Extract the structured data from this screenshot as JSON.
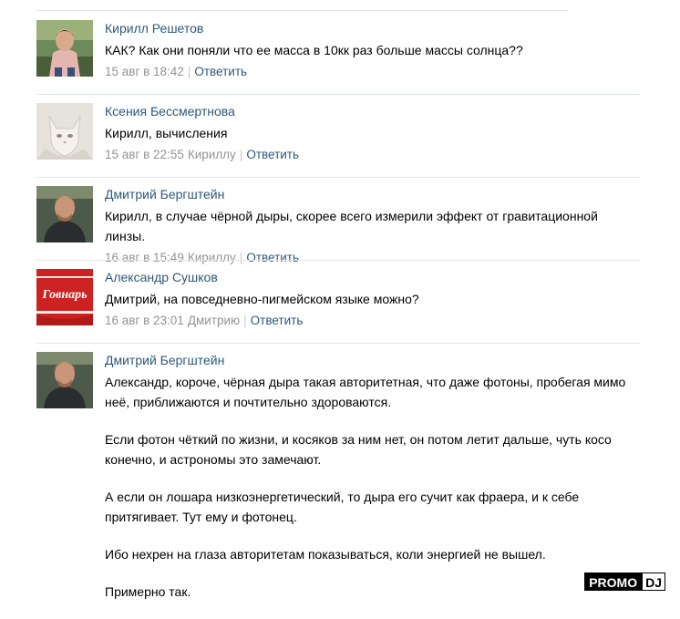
{
  "comments": [
    {
      "author": "Кирилл Решетов",
      "text": "КАК? Как они поняли что ее масса в 10кк раз больше массы солнца??",
      "date": "15 авг в 18:42",
      "reply_to": "",
      "reply_label": "Ответить"
    },
    {
      "author": "Ксения Бессмертнова",
      "text": "Кирилл, вычисления",
      "date": "15 авг в 22:55",
      "reply_to": "Кириллу",
      "reply_label": "Ответить"
    },
    {
      "author": "Дмитрий Бергштейн",
      "text": "Кирилл, в случае чёрной дыры, скорее всего измерили эффект от гравитационной линзы.",
      "date": "16 авг в 15:49",
      "reply_to": "Кириллу",
      "reply_label": "Ответить"
    },
    {
      "author": "Александр Сушков",
      "text": "Дмитрий, на повседневно-пигмейском языке можно?",
      "date": "16 авг в 23:01",
      "reply_to": "Дмитрию",
      "reply_label": "Ответить",
      "avatar_logo_text": "Говнарь"
    },
    {
      "author": "Дмитрий Бергштейн",
      "paragraphs": [
        "Александр, короче, чёрная дыра такая авторитетная, что даже фотоны, пробегая мимо неё, приближаются и почтительно здороваются.",
        "Если фотон чёткий по жизни, и косяков за ним нет, он потом летит дальше, чуть косо конечно, и астрономы это замечают.",
        "А если он лошара низкоэнергетический, то дыра его сучит как фраера, и к себе притягивает. Тут ему и фотонец.",
        "Ибо нехрен на глаза авторитетам показываться, коли энергией не вышел.",
        "Примерно так."
      ]
    }
  ],
  "watermark": {
    "part1": "PROMO",
    "part2": "DJ"
  },
  "colors": {
    "link": "#2b587a",
    "meta": "#939393",
    "divider": "#e3e6ea"
  }
}
